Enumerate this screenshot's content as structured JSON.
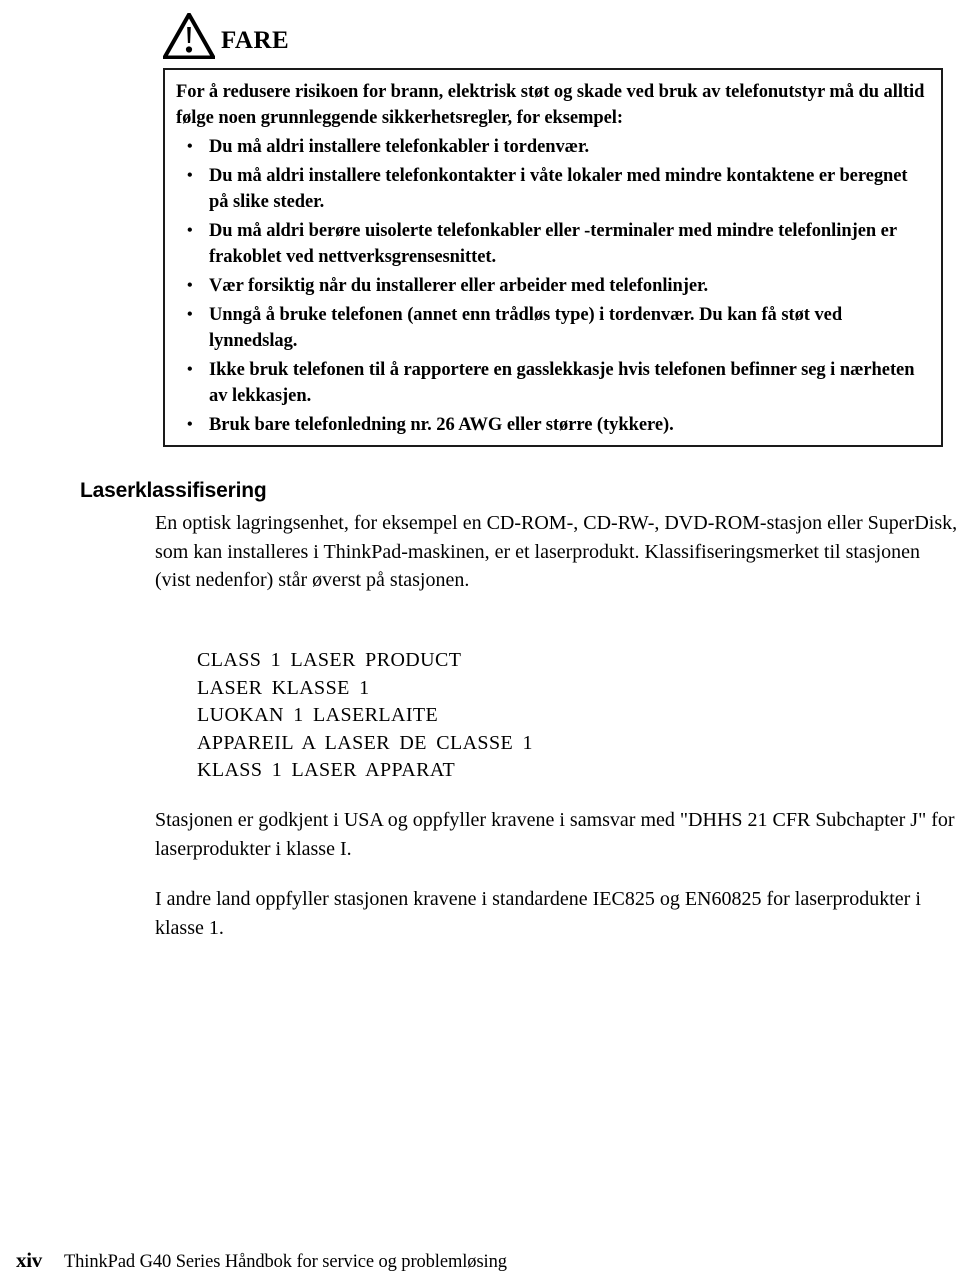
{
  "danger": {
    "icon": "warning-triangle-icon",
    "label": "FARE",
    "lead": "For å redusere risikoen for brann, elektrisk støt og skade ved bruk av telefonutstyr må du alltid følge noen grunnleggende sikkerhetsregler, for eksempel:",
    "bullet_char": "•",
    "bullets": [
      "Du må aldri installere telefonkabler i tordenvær.",
      "Du må aldri installere telefonkontakter i våte lokaler med mindre kontaktene er beregnet på slike steder.",
      "Du må aldri berøre uisolerte telefonkabler eller -terminaler med mindre telefonlinjen er frakoblet ved nettverksgrensesnittet.",
      "Vær forsiktig når du installerer eller arbeider med telefonlinjer.",
      "Unngå å bruke telefonen (annet enn trådløs type) i tordenvær. Du kan få støt ved lynnedslag.",
      "Ikke bruk telefonen til å rapportere en gasslekkasje hvis telefonen befinner seg i nærheten av lekkasjen.",
      "Bruk bare telefonledning nr. 26 AWG eller større (tykkere)."
    ]
  },
  "laser_section": {
    "heading": "Laserklassifisering",
    "intro": "En optisk lagringsenhet, for eksempel en CD-ROM-, CD-RW-, DVD-ROM-stasjon eller SuperDisk, som kan installeres i ThinkPad-maskinen, er et laserprodukt. Klassifiseringsmerket til stasjonen (vist nedenfor) står øverst på stasjonen.",
    "label_lines": [
      "CLASS 1 LASER PRODUCT",
      "LASER KLASSE 1",
      "LUOKAN 1 LASERLAITE",
      "APPAREIL A LASER DE CLASSE 1",
      "KLASS 1 LASER APPARAT"
    ],
    "dhhs_paragraph": "Stasjonen er godkjent i USA og oppfyller kravene i samsvar med \"DHHS 21 CFR Subchapter J\" for laserprodukter i klasse I.",
    "other_countries_paragraph": "I andre land oppfyller stasjonen kravene i standardene IEC825 og EN60825 for laserprodukter i klasse 1."
  },
  "footer": {
    "page_number": "xiv",
    "title": "ThinkPad G40 Series Håndbok for service og problemløsing"
  },
  "colors": {
    "text": "#000000",
    "box_border": "#1a1a1a",
    "page_background": "#ffffff"
  }
}
